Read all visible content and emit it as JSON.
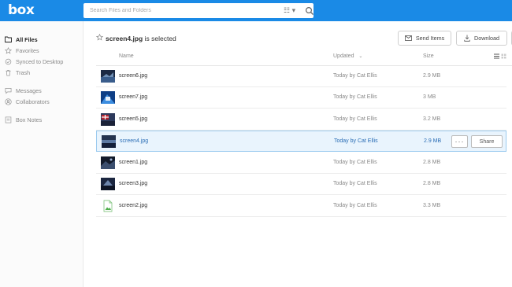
{
  "app": {
    "logo": "box"
  },
  "search": {
    "placeholder": "Search Files and Folders",
    "filter_symbol": "☷ ▾"
  },
  "sidebar": {
    "items": [
      {
        "label": "All Files",
        "icon": "folder-icon",
        "active": true
      },
      {
        "label": "Favorites",
        "icon": "star-icon"
      },
      {
        "label": "Synced to Desktop",
        "icon": "sync-icon"
      },
      {
        "label": "Trash",
        "icon": "trash-icon"
      },
      {
        "label": "Messages",
        "icon": "message-icon"
      },
      {
        "label": "Collaborators",
        "icon": "user-icon"
      },
      {
        "label": "Box Notes",
        "icon": "notes-icon"
      }
    ]
  },
  "header": {
    "selected_file": "screen4.jpg",
    "selected_suffix": " is selected",
    "send_items": "Send Items",
    "download": "Download"
  },
  "table": {
    "columns": {
      "name": "Name",
      "updated": "Updated",
      "updated_sort": "⌄",
      "size": "Size"
    },
    "rows": [
      {
        "name": "screen6.jpg",
        "updated": "Today by Cat Ellis",
        "size": "2.9 MB",
        "thumb": "dark-blue-photo"
      },
      {
        "name": "screen7.jpg",
        "updated": "Today by Cat Ellis",
        "size": "3 MB",
        "thumb": "blue-photo"
      },
      {
        "name": "screen5.jpg",
        "updated": "Today by Cat Ellis",
        "size": "3.2 MB",
        "thumb": "flag-photo"
      },
      {
        "name": "screen4.jpg",
        "updated": "Today by Cat Ellis",
        "size": "2.9 MB",
        "thumb": "sea-photo",
        "selected": true
      },
      {
        "name": "screen1.jpg",
        "updated": "Today by Cat Ellis",
        "size": "2.8 MB",
        "thumb": "dark-photo"
      },
      {
        "name": "screen3.jpg",
        "updated": "Today by Cat Ellis",
        "size": "2.8 MB",
        "thumb": "night-photo"
      },
      {
        "name": "screen2.jpg",
        "updated": "Today by Cat Ellis",
        "size": "3.3 MB",
        "thumb": "image-file-icon"
      }
    ],
    "row_actions": {
      "more": "···",
      "share": "Share"
    }
  },
  "colors": {
    "brand": "#1a8ae6",
    "selected_bg": "#e9f4fd",
    "selected_text": "#2a6db5"
  }
}
